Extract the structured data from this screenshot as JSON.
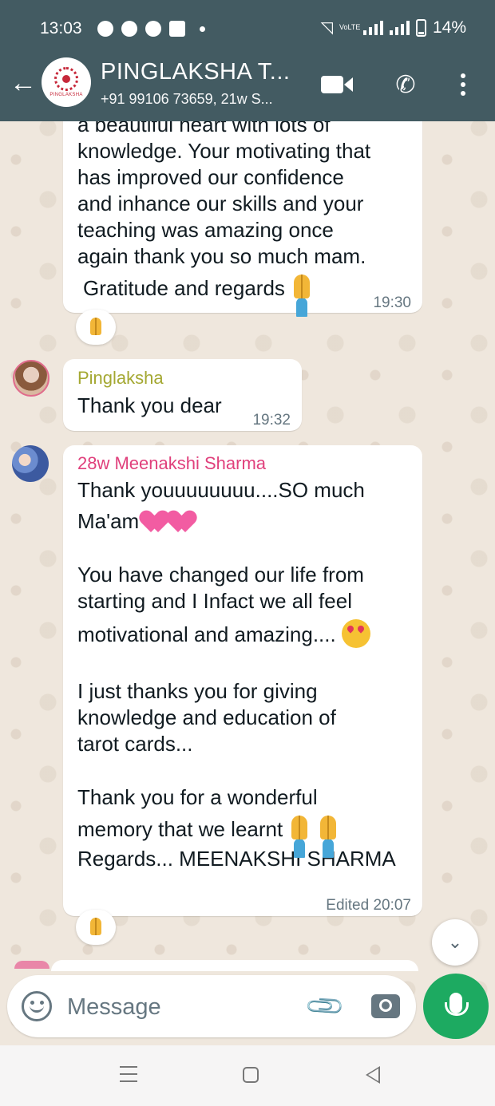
{
  "status_bar": {
    "time": "13:03",
    "battery": "14%",
    "network_label": "VoLTE"
  },
  "header": {
    "title": "PINGLAKSHA T...",
    "subtitle": "+91 99106 73659, 21w S...",
    "logo_text": "PINGLAKSHA"
  },
  "messages": [
    {
      "text_lines": [
        "a beautiful heart with lots of",
        "knowledge. Your motivating that",
        "has improved our confidence",
        "and inhance our skills and your",
        "teaching was amazing  once",
        "again thank you so much mam."
      ],
      "closing": "Gratitude and regards",
      "time": "19:30"
    },
    {
      "sender": "Pinglaksha",
      "text": "Thank you dear",
      "time": "19:32"
    },
    {
      "sender": "28w Meenakshi Sharma",
      "para1a": "Thank youuuuuuuu....SO much",
      "para1b": "Ma'am",
      "para2a": "You have changed our life from",
      "para2b": "starting and I Infact we all feel",
      "para2c": "motivational and amazing....",
      "para3a": "I just thanks you for giving",
      "para3b": "knowledge and education of",
      "para3c": "tarot cards...",
      "para4a": "Thank you for a wonderful",
      "para4b": "memory that we learnt",
      "para4c": "Regards... MEENAKSHI SHARMA",
      "edited": "Edited",
      "time": "20:07"
    }
  ],
  "composer": {
    "placeholder": "Message"
  },
  "colors": {
    "header_bg": "#435b62",
    "pinglaksha_name": "#a4a832",
    "meenakshi_name": "#e0407c",
    "mic_button": "#1daa61"
  }
}
